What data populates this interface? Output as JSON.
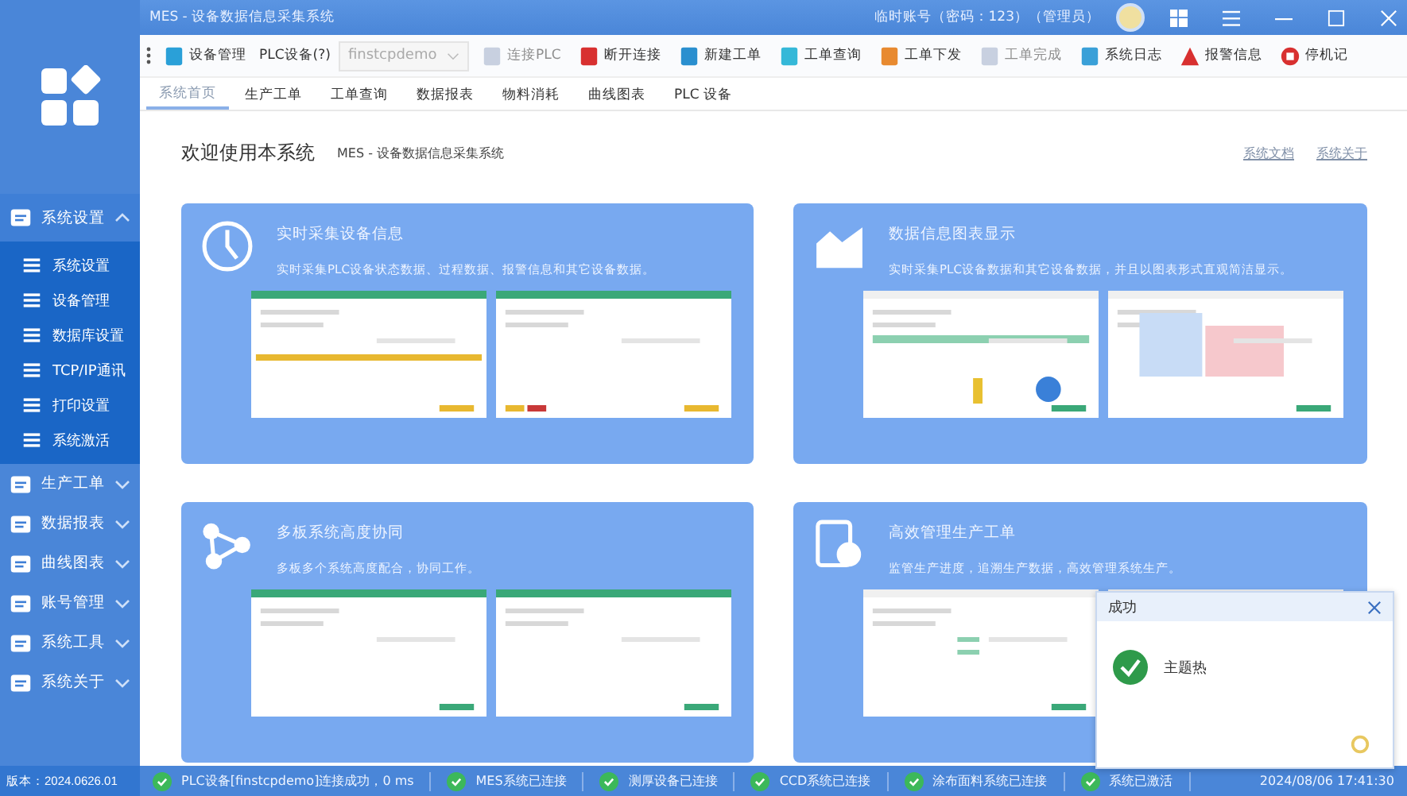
{
  "window": {
    "title": "MES - 设备数据信息采集系统",
    "account": "临时账号（密码：123）（管理员）"
  },
  "toolbar": [
    {
      "label": "设备管理",
      "kind": "button",
      "disabled": false
    },
    {
      "label": "PLC设备(?)",
      "kind": "label"
    },
    {
      "label": "finstcpdemo",
      "kind": "dropdown",
      "disabled": true
    },
    {
      "label": "连接PLC",
      "kind": "button",
      "disabled": true
    },
    {
      "label": "断开连接",
      "kind": "button",
      "disabled": false
    },
    {
      "label": "新建工单",
      "kind": "button",
      "disabled": false
    },
    {
      "label": "工单查询",
      "kind": "button",
      "disabled": false
    },
    {
      "label": "工单下发",
      "kind": "button",
      "disabled": false
    },
    {
      "label": "工单完成",
      "kind": "button",
      "disabled": true
    },
    {
      "label": "系统日志",
      "kind": "button",
      "disabled": false
    },
    {
      "label": "报警信息",
      "kind": "button",
      "disabled": false
    },
    {
      "label": "停机记",
      "kind": "button",
      "disabled": false
    }
  ],
  "tabs": [
    {
      "label": "系统首页",
      "selected": true
    },
    {
      "label": "生产工单",
      "selected": false
    },
    {
      "label": "工单查询",
      "selected": false
    },
    {
      "label": "数据报表",
      "selected": false
    },
    {
      "label": "物料消耗",
      "selected": false
    },
    {
      "label": "曲线图表",
      "selected": false
    },
    {
      "label": "PLC 设备",
      "selected": false
    }
  ],
  "sidebar": {
    "groups": [
      {
        "label": "系统设置",
        "expanded": true,
        "children": [
          {
            "label": "系统设置"
          },
          {
            "label": "设备管理"
          },
          {
            "label": "数据库设置"
          },
          {
            "label": "TCP/IP通讯"
          },
          {
            "label": "打印设置"
          },
          {
            "label": "系统激活"
          }
        ]
      },
      {
        "label": "生产工单",
        "expanded": false
      },
      {
        "label": "数据报表",
        "expanded": false
      },
      {
        "label": "曲线图表",
        "expanded": false
      },
      {
        "label": "账号管理",
        "expanded": false
      },
      {
        "label": "系统工具",
        "expanded": false
      },
      {
        "label": "系统关于",
        "expanded": false
      }
    ],
    "version": "版本：2024.0626.01"
  },
  "home": {
    "heading": "欢迎使用本系统",
    "subtitle": "MES - 设备数据信息采集系统",
    "links": [
      "系统文档",
      "系统关于"
    ],
    "cards": [
      {
        "title": "实时采集设备信息",
        "text": "实时采集PLC设备状态数据、过程数据、报警信息和其它设备数据。"
      },
      {
        "title": "数据信息图表显示",
        "text": "实时采集PLC设备数据和其它设备数据，并且以图表形式直观简洁显示。"
      },
      {
        "title": "多板系统高度协同",
        "text": "多板多个系统高度配合，协同工作。"
      },
      {
        "title": "高效管理生产工单",
        "text": "监管生产进度，追溯生产数据，高效管理系统生产。"
      }
    ]
  },
  "toast": {
    "title": "成功",
    "message": "主题热"
  },
  "status_bar": {
    "items": [
      "PLC设备[finstcpdemo]连接成功，0 ms",
      "MES系统已连接",
      "测厚设备已连接",
      "CCD系统已连接",
      "涂布面料系统已连接",
      "系统已激活"
    ],
    "time": "2024/08/06 17:41:30"
  }
}
